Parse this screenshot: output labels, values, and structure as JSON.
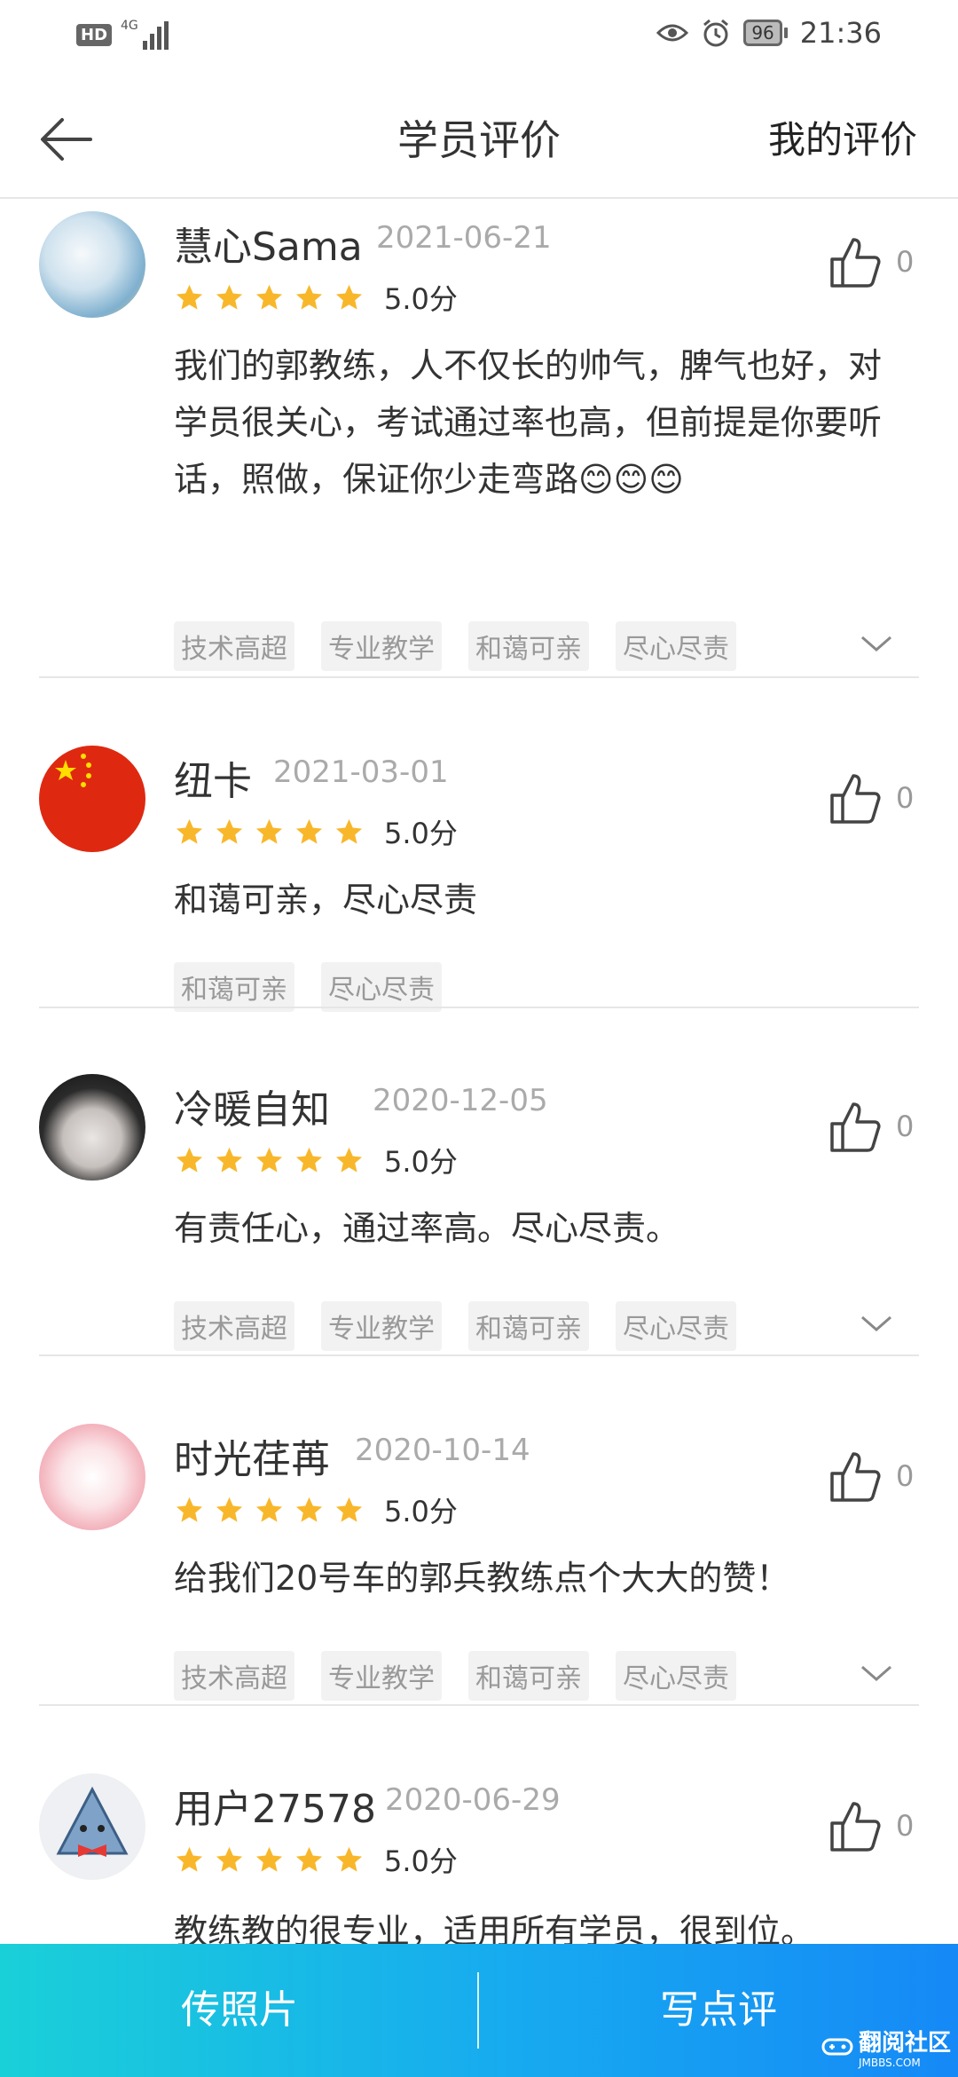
{
  "status_bar": {
    "hd": "HD",
    "network": "4G",
    "battery": "96",
    "time": "21:36"
  },
  "header": {
    "title": "学员评价",
    "my_reviews": "我的评价"
  },
  "reviews": [
    {
      "name": "慧心Sama",
      "date": "2021-06-21",
      "rating": 5,
      "score": "5.0分",
      "likes": "0",
      "text": "我们的郭教练，人不仅长的帅气，脾气也好，对学员很关心，考试通过率也高，但前提是你要听话，照做，保证你少走弯路😊😊😊",
      "tags": [
        "技术高超",
        "专业教学",
        "和蔼可亲",
        "尽心尽责"
      ]
    },
    {
      "name": "纽卡",
      "date": "2021-03-01",
      "rating": 5,
      "score": "5.0分",
      "likes": "0",
      "text": "和蔼可亲，尽心尽责",
      "tags": [
        "和蔼可亲",
        "尽心尽责"
      ]
    },
    {
      "name": "冷暖自知",
      "date": "2020-12-05",
      "rating": 5,
      "score": "5.0分",
      "likes": "0",
      "text": "有责任心，通过率高。尽心尽责。",
      "tags": [
        "技术高超",
        "专业教学",
        "和蔼可亲",
        "尽心尽责"
      ]
    },
    {
      "name": "时光荏苒",
      "date": "2020-10-14",
      "rating": 5,
      "score": "5.0分",
      "likes": "0",
      "text": "给我们20号车的郭兵教练点个大大的赞！",
      "tags": [
        "技术高超",
        "专业教学",
        "和蔼可亲",
        "尽心尽责"
      ]
    },
    {
      "name": "用户27578",
      "date": "2020-06-29",
      "rating": 5,
      "score": "5.0分",
      "likes": "0",
      "text": "教练教的很专业，适用所有学员，很到位。",
      "tags": []
    }
  ],
  "bottom_bar": {
    "upload_photo": "传照片",
    "write_review": "写点评"
  },
  "watermark": {
    "text": "翻阅社区",
    "sub": "JMBBS.COM"
  },
  "colors": {
    "star": "#f8b72a",
    "accent_gradient_start": "#1ad0d8",
    "accent_gradient_end": "#1589f6"
  }
}
